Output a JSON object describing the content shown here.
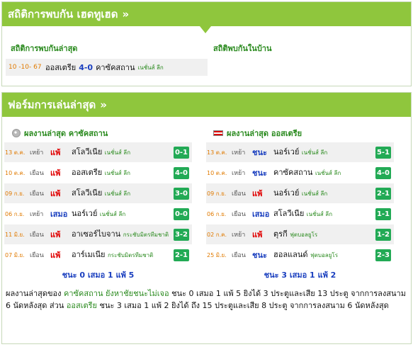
{
  "h2h": {
    "title": "สถิติการพบกัน เฮดทูเฮด",
    "chevron": "»",
    "latest_title": "สถิติการพบกันล่าสุด",
    "home_title": "สถิติพบกันในบ้าน",
    "match": {
      "date": "10 -10- 67",
      "home": "ออสเตรีย",
      "score": "4-0",
      "away": "คาซัคสถาน",
      "league": "เนชั่นส์ ลีก"
    }
  },
  "form": {
    "title": "ฟอร์มการเล่นล่าสุด",
    "chevron": "»",
    "left": {
      "heading": "ผลงานล่าสุด คาซัคสถาน",
      "rows": [
        {
          "date": "13 ต.ค.",
          "venue": "เหย้า",
          "result": "แพ้",
          "rtype": "loss",
          "opp": "สโลวีเนีย",
          "league": "เนชั่นส์ ลีก",
          "score": "0-1"
        },
        {
          "date": "10 ต.ค.",
          "venue": "เยือน",
          "result": "แพ้",
          "rtype": "loss",
          "opp": "ออสเตรีย",
          "league": "เนชั่นส์ ลีก",
          "score": "4-0"
        },
        {
          "date": "09 ก.ย.",
          "venue": "เยือน",
          "result": "แพ้",
          "rtype": "loss",
          "opp": "สโลวีเนีย",
          "league": "เนชั่นส์ ลีก",
          "score": "3-0"
        },
        {
          "date": "06 ก.ย.",
          "venue": "เหย้า",
          "result": "เสมอ",
          "rtype": "draw",
          "opp": "นอร์เวย์",
          "league": "เนชั่นส์ ลีก",
          "score": "0-0"
        },
        {
          "date": "11 มิ.ย.",
          "venue": "เยือน",
          "result": "แพ้",
          "rtype": "loss",
          "opp": "อาเซอร์ไบจาน",
          "league": "กระชับมิตรทีมชาติ",
          "score": "3-2"
        },
        {
          "date": "07 มิ.ย.",
          "venue": "เยือน",
          "result": "แพ้",
          "rtype": "loss",
          "opp": "อาร์เมเนีย",
          "league": "กระชับมิตรทีมชาติ",
          "score": "2-1"
        }
      ],
      "summary": "ชนะ 0 เสมอ 1 แพ้ 5"
    },
    "right": {
      "heading": "ผลงานล่าสุด ออสเตรีย",
      "rows": [
        {
          "date": "13 ต.ค.",
          "venue": "เหย้า",
          "result": "ชนะ",
          "rtype": "win",
          "opp": "นอร์เวย์",
          "league": "เนชั่นส์ ลีก",
          "score": "5-1"
        },
        {
          "date": "10 ต.ค.",
          "venue": "เหย้า",
          "result": "ชนะ",
          "rtype": "win",
          "opp": "คาซัคสถาน",
          "league": "เนชั่นส์ ลีก",
          "score": "4-0"
        },
        {
          "date": "09 ก.ย.",
          "venue": "เยือน",
          "result": "แพ้",
          "rtype": "loss",
          "opp": "นอร์เวย์",
          "league": "เนชั่นส์ ลีก",
          "score": "2-1"
        },
        {
          "date": "06 ก.ย.",
          "venue": "เยือน",
          "result": "เสมอ",
          "rtype": "draw",
          "opp": "สโลวีเนีย",
          "league": "เนชั่นส์ ลีก",
          "score": "1-1"
        },
        {
          "date": "02 ก.ค.",
          "venue": "เหย้า",
          "result": "แพ้",
          "rtype": "loss",
          "opp": "ตุรกี",
          "league": "ฟุตบอลยูโร",
          "score": "1-2"
        },
        {
          "date": "25 มิ.ย.",
          "venue": "เยือน",
          "result": "ชนะ",
          "rtype": "win",
          "opp": "ฮอลแลนด์",
          "league": "ฟุตบอลยูโร",
          "score": "2-3"
        }
      ],
      "summary": "ชนะ 3 เสมอ 1 แพ้ 2"
    }
  },
  "footer": {
    "p1": "ผลงานล่าสุดของ ",
    "team1": "คาซัคสถาน",
    "p2": " ยังหาชัยชนะไม่เจอ",
    "p3": " ชนะ 0 เสมอ 1 แพ้ 5 ยิงได้ 3 ประตูและเสีย 13 ประตู จากการลงสนาม 6 นัดหลังสุด ส่วน ",
    "team2": "ออสเตรีย",
    "p4": " ชนะ 3 เสมอ 1 แพ้ 2 ยิงได้ ถึง 15 ประตูและเสีย 8 ประตู จากการลงสนาม 6 นัดหลังสุด"
  }
}
